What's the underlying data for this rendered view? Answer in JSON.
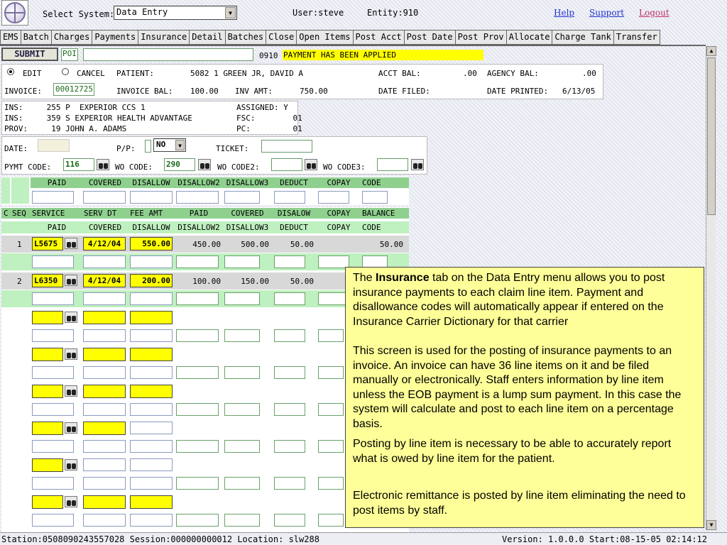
{
  "header": {
    "select_system_label": "Select System:",
    "system_value": "Data Entry",
    "user_label": "User:steve",
    "entity_label": "Entity:910",
    "help": "Help",
    "support": "Support",
    "logout": "Logout"
  },
  "tabs": [
    "EMS",
    "Batch",
    "Charges",
    "Payments",
    "Insurance",
    "Detail",
    "Batches",
    "Close",
    "Open Items",
    "Post Acct",
    "Post Date",
    "Post Prov",
    "Allocate",
    "Charge Tank",
    "Transfer"
  ],
  "toolbar": {
    "submit": "SUBMIT",
    "poi": "POI",
    "code": "0910",
    "message": "PAYMENT HAS BEEN APPLIED"
  },
  "patient": {
    "edit": "EDIT",
    "cancel": "CANCEL",
    "patient_label": "PATIENT:",
    "patient_value": "5082  1 GREEN JR, DAVID A",
    "acct_bal_label": "ACCT BAL:",
    "acct_bal": ".00",
    "agency_bal_label": "AGENCY BAL:",
    "agency_bal": ".00",
    "invoice_label": "INVOICE:",
    "invoice_value": "00012725",
    "invoice_bal_label": "INVOICE BAL:",
    "invoice_bal": "100.00",
    "inv_amt_label": "INV AMT:",
    "inv_amt": "750.00",
    "date_filed_label": "DATE FILED:",
    "date_printed_label": "DATE PRINTED:",
    "date_printed": "6/13/05"
  },
  "insurance": {
    "ins1": "INS:     255 P  EXPERIOR CCS 1",
    "ins2": "INS:     359 S EXPERIOR HEALTH ADVANTAGE",
    "prov": "PROV:     19 JOHN A. ADAMS",
    "assigned": "ASSIGNED: Y",
    "fsc": "FSC:        01",
    "pc": "PC:         01"
  },
  "payment": {
    "date_label": "DATE:",
    "pp_label": "P/P:",
    "pp_value": "NO",
    "ticket_label": "TICKET:",
    "pymt_code_label": "PYMT CODE:",
    "pymt_code": "116",
    "wo_code_label": "WO CODE:",
    "wo_code": "290",
    "wo_code2_label": "WO CODE2:",
    "wo_code3_label": "WO CODE3:"
  },
  "grid": {
    "top_headers": [
      "PAID",
      "COVERED",
      "DISALLOW",
      "DISALLOW2",
      "DISALLOW3",
      "DEDUCT",
      "COPAY",
      "CODE"
    ],
    "headers1": [
      "C",
      "SEQ",
      "SERVICE",
      "SERV DT",
      "FEE AMT",
      "PAID",
      "COVERED",
      "DISALOW",
      "COPAY",
      "BALANCE"
    ],
    "headers2": [
      "PAID",
      "COVERED",
      "DISALLOW",
      "DISALLOW2",
      "DISALLOW3",
      "DEDUCT",
      "COPAY",
      "CODE"
    ],
    "rows": [
      {
        "seq": "1",
        "service": "L5675",
        "serv_dt": "4/12/04",
        "fee": "550.00",
        "paid": "450.00",
        "covered": "500.00",
        "disallow": "50.00",
        "copay": "",
        "balance": "50.00"
      },
      {
        "seq": "2",
        "service": "L6350",
        "serv_dt": "4/12/04",
        "fee": "200.00",
        "paid": "100.00",
        "covered": "150.00",
        "disallow": "50.00",
        "copay": "",
        "balance": ""
      }
    ]
  },
  "callout": {
    "p1_pre": "The ",
    "p1_bold": "Insurance",
    "p1_post": " tab on the Data Entry menu allows you to post insurance payments to each claim line item.  Payment and disallowance codes will automatically appear if entered on the Insurance Carrier Dictionary for that carrier",
    "p2": "This screen is used for the posting of insurance payments to an invoice.  An invoice can have 36 line items on it and be filed manually or electronically.  Staff enters information by line item unless the EOB payment is a lump sum payment.  In this case the system will calculate and post to each line item on a percentage basis.",
    "p3": "Posting by line item is necessary to be able to accurately report what is owed by line item for the patient.",
    "p4": "Electronic remittance is posted by line item eliminating the need to post items by staff."
  },
  "status": {
    "left": "Station:0508090243557028 Session:000000000012 Location: slw288",
    "right": "Version: 1.0.0.0 Start:08-15-05 02:14:12"
  },
  "colors": {
    "highlight": "#ffff00",
    "header_green": "#8fd08f",
    "row_green": "#bff0bf",
    "callout": "#ffff99"
  }
}
